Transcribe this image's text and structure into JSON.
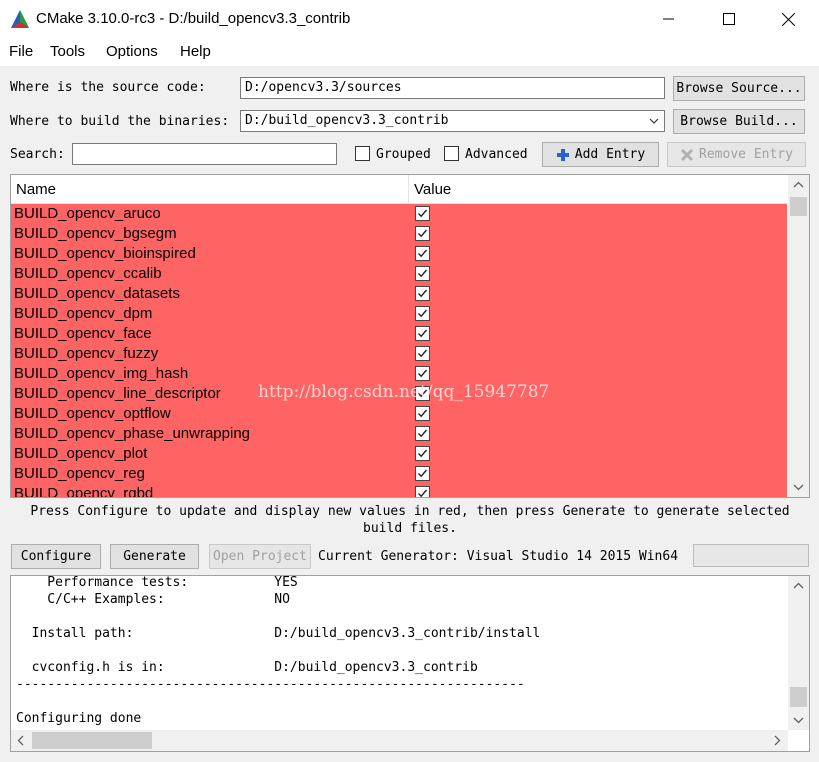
{
  "window": {
    "title": "CMake 3.10.0-rc3 - D:/build_opencv3.3_contrib"
  },
  "menu": [
    "File",
    "Tools",
    "Options",
    "Help"
  ],
  "source": {
    "label": "Where is the source code:",
    "value": "D:/opencv3.3/sources",
    "browse_label": "Browse Source..."
  },
  "build": {
    "label": "Where to build the binaries:",
    "value": "D:/build_opencv3.3_contrib",
    "browse_label": "Browse Build..."
  },
  "search": {
    "label": "Search:",
    "value": "",
    "grouped_label": "Grouped",
    "grouped_checked": false,
    "advanced_label": "Advanced",
    "advanced_checked": false,
    "add_label": "Add Entry",
    "remove_label": "Remove Entry"
  },
  "table": {
    "headers": [
      "Name",
      "Value"
    ],
    "row_color": "#ff6464",
    "rows": [
      {
        "name": "BUILD_opencv_aruco",
        "checked": true
      },
      {
        "name": "BUILD_opencv_bgsegm",
        "checked": true
      },
      {
        "name": "BUILD_opencv_bioinspired",
        "checked": true
      },
      {
        "name": "BUILD_opencv_ccalib",
        "checked": true
      },
      {
        "name": "BUILD_opencv_datasets",
        "checked": true
      },
      {
        "name": "BUILD_opencv_dpm",
        "checked": true
      },
      {
        "name": "BUILD_opencv_face",
        "checked": true
      },
      {
        "name": "BUILD_opencv_fuzzy",
        "checked": true
      },
      {
        "name": "BUILD_opencv_img_hash",
        "checked": true
      },
      {
        "name": "BUILD_opencv_line_descriptor",
        "checked": true
      },
      {
        "name": "BUILD_opencv_optflow",
        "checked": true
      },
      {
        "name": "BUILD_opencv_phase_unwrapping",
        "checked": true
      },
      {
        "name": "BUILD_opencv_plot",
        "checked": true
      },
      {
        "name": "BUILD_opencv_reg",
        "checked": true
      },
      {
        "name": "BUILD_opencv_rgbd",
        "checked": true
      }
    ],
    "watermark": "http://blog.csdn.net/qq_15947787"
  },
  "hint": "Press Configure to update and display new values in red, then press Generate to generate selected build files.",
  "actions": {
    "configure_label": "Configure",
    "generate_label": "Generate",
    "open_project_label": "Open Project",
    "generator_text": "Current Generator: Visual Studio 14 2015 Win64"
  },
  "output": {
    "lines": [
      "    Performance tests:           YES",
      "    C/C++ Examples:              NO",
      "",
      "  Install path:                  D:/build_opencv3.3_contrib/install",
      "",
      "  cvconfig.h is in:              D:/build_opencv3.3_contrib",
      "-----------------------------------------------------------------",
      "",
      "Configuring done"
    ]
  }
}
